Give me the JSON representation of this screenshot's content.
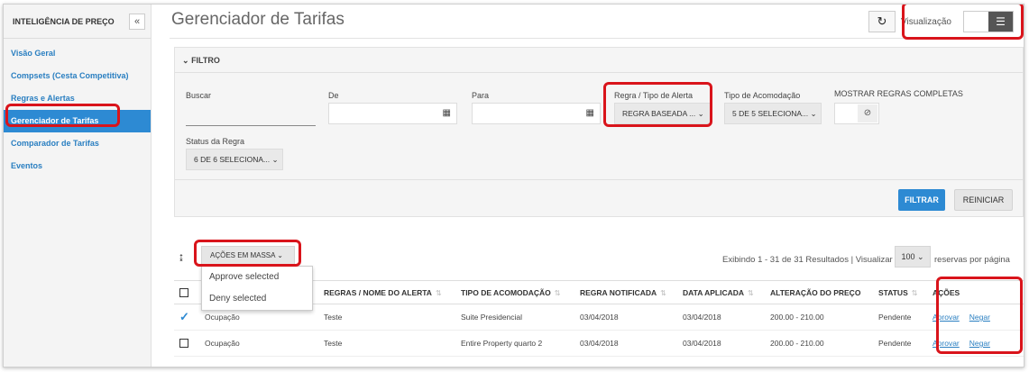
{
  "sidebar": {
    "title": "INTELIGÊNCIA DE PREÇO",
    "collapse_icon": "«",
    "items": [
      {
        "label": "Visão Geral"
      },
      {
        "label": "Compsets (Cesta Competitiva)"
      },
      {
        "label": "Regras e Alertas"
      },
      {
        "label": "Gerenciador de Tarifas",
        "active": true
      },
      {
        "label": "Comparador de Tarifas"
      },
      {
        "label": "Eventos"
      }
    ]
  },
  "header": {
    "title": "Gerenciador de Tarifas",
    "refresh_icon": "refresh-icon",
    "view_label": "Visualização",
    "view_icon": "list-icon"
  },
  "filter": {
    "heading": "FILTRO",
    "search_label": "Buscar",
    "search_value": "",
    "from_label": "De",
    "from_value": "",
    "to_label": "Para",
    "to_value": "",
    "rule_type_label": "Regra / Tipo de Alerta",
    "rule_type_value": "REGRA BASEADA ...",
    "room_type_label": "Tipo de Acomodação",
    "room_type_value": "5 DE 5 SELECIONA...",
    "show_complete_label": "MOSTRAR REGRAS COMPLETAS",
    "status_label": "Status da Regra",
    "status_value": "6 DE 6 SELECIONA...",
    "filter_button": "FILTRAR",
    "reset_button": "REINICIAR"
  },
  "toolbar": {
    "bulk_actions": "AÇÕES EM MASSA",
    "bulk_menu": [
      "Approve selected",
      "Deny selected"
    ],
    "results_text": "Exibindo 1 - 31 de 31 Resultados | Visualizar",
    "per_page_value": "100",
    "per_page_label": "reservas por página"
  },
  "table": {
    "columns": [
      "",
      "",
      "REGRAS / NOME DO ALERTA",
      "TIPO DE ACOMODAÇÃO",
      "REGRA NOTIFICADA",
      "DATA APLICADA",
      "ALTERAÇÃO DO PREÇO",
      "STATUS",
      "AÇÕES"
    ],
    "rows": [
      {
        "checked": true,
        "type": "Ocupação",
        "name": "Teste",
        "room": "Suite Presidencial",
        "notified": "03/04/2018",
        "applied": "03/04/2018",
        "change": "200.00 - 210.00",
        "status": "Pendente",
        "approve": "Aprovar",
        "deny": "Negar"
      },
      {
        "checked": false,
        "type": "Ocupação",
        "name": "Teste",
        "room": "Entire Property quarto 2",
        "notified": "03/04/2018",
        "applied": "03/04/2018",
        "change": "200.00 - 210.00",
        "status": "Pendente",
        "approve": "Aprovar",
        "deny": "Negar"
      }
    ]
  },
  "colors": {
    "accent": "#2d8ad3",
    "highlight": "#d9141b"
  }
}
